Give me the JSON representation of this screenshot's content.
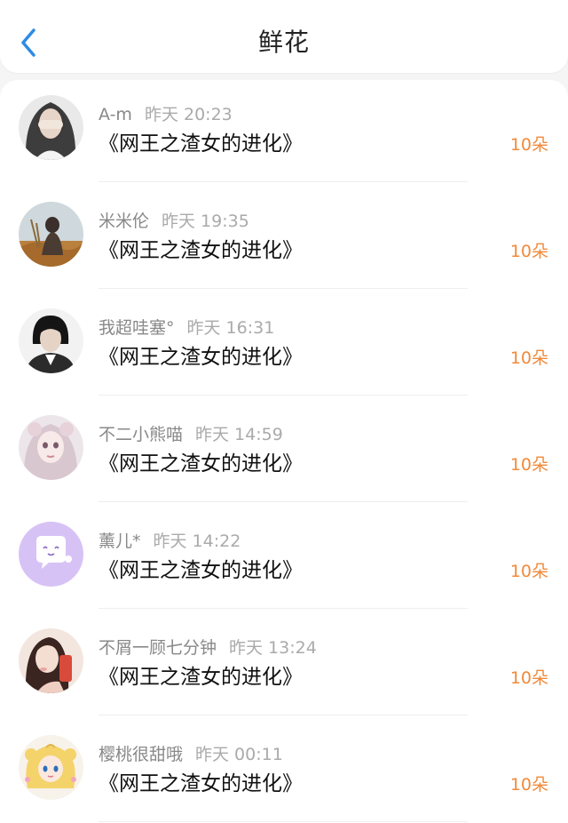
{
  "navbar": {
    "title": "鲜花",
    "back_icon": "chevron-left-icon",
    "accent_color": "#2d8ce6"
  },
  "list": {
    "count_color": "#f08a3c",
    "items": [
      {
        "name": "A-m",
        "time": "昨天 20:23",
        "book": "《网王之渣女的进化》",
        "count": "10朵"
      },
      {
        "name": "米米伦",
        "time": "昨天 19:35",
        "book": "《网王之渣女的进化》",
        "count": "10朵"
      },
      {
        "name": "我超哇塞°",
        "time": "昨天 16:31",
        "book": "《网王之渣女的进化》",
        "count": "10朵"
      },
      {
        "name": "不二小熊喵",
        "time": "昨天 14:59",
        "book": "《网王之渣女的进化》",
        "count": "10朵"
      },
      {
        "name": "薰儿*",
        "time": "昨天 14:22",
        "book": "《网王之渣女的进化》",
        "count": "10朵"
      },
      {
        "name": "不屑一顾七分钟",
        "time": "昨天 13:24",
        "book": "《网王之渣女的进化》",
        "count": "10朵"
      },
      {
        "name": "樱桃很甜哦",
        "time": "昨天 00:11",
        "book": "《网王之渣女的进化》",
        "count": "10朵"
      }
    ]
  }
}
